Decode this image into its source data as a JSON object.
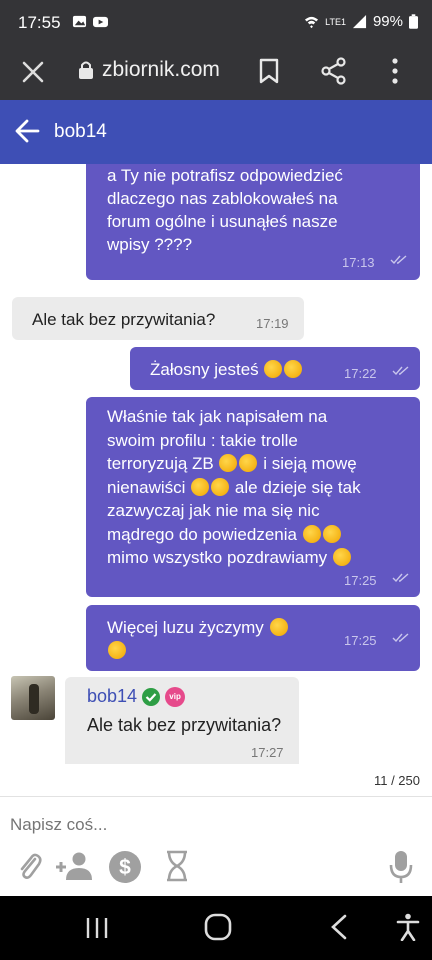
{
  "status_bar": {
    "time": "17:55",
    "network": "LTE1",
    "battery": "99%"
  },
  "browser": {
    "url": "zbiornik.com"
  },
  "header": {
    "title": "bob14"
  },
  "messages": [
    {
      "direction": "out",
      "text_lines": [
        "a Ty nie potrafisz odpowiedzieć",
        "dlaczego nas zablokowałeś na",
        "forum ogólne i usunąłeś nasze",
        "wpisy ????"
      ],
      "time": "17:13"
    },
    {
      "direction": "in",
      "text": "Ale tak bez przywitania?",
      "time": "17:19"
    },
    {
      "direction": "out",
      "text": "Żałosny jesteś",
      "time": "17:22"
    },
    {
      "direction": "out",
      "text_lines": [
        "Właśnie tak jak napisałem na",
        "swoim profilu : takie trolle",
        "terroryzują ZB",
        "i sieją mowę",
        "nienawiści",
        "ale dzieje się tak",
        "zazwyczaj jak nie ma się nic",
        "mądrego do powiedzenia",
        "mimo wszystko pozdrawiamy"
      ],
      "time": "17:25"
    },
    {
      "direction": "out",
      "text": "Więcej luzu życzymy",
      "time": "17:25"
    },
    {
      "direction": "in",
      "sender": "bob14",
      "badge": "vip",
      "text": "Ale tak bez przywitania?",
      "time": "17:27"
    }
  ],
  "counter": "11 / 250",
  "composer": {
    "placeholder": "Napisz coś..."
  },
  "colors": {
    "header": "#3e4fb5",
    "outgoing_bubble": "#6257c2",
    "incoming_bubble": "#ebebeb",
    "status_bar": "#343437"
  }
}
